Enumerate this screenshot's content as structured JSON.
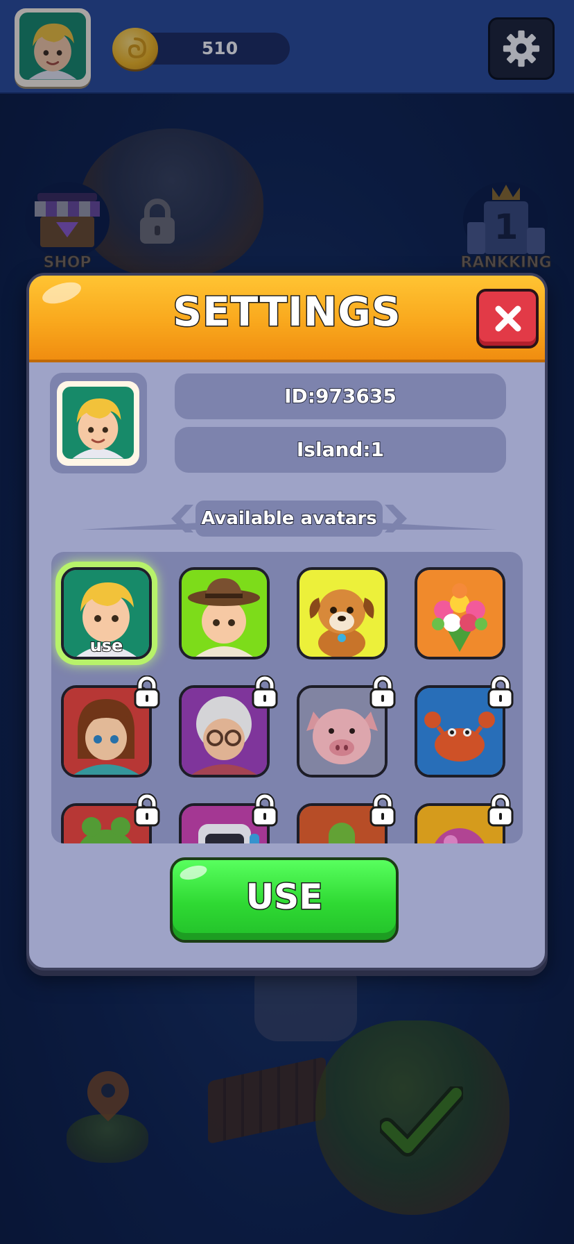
{
  "hud": {
    "coins": "510"
  },
  "background": {
    "shop_label": "SHOP",
    "ranking_label": "RANKKING",
    "ranking_number": "1"
  },
  "settings": {
    "title": "SETTINGS",
    "player_id": "ID:973635",
    "island": "Island:1",
    "section_title": "Available avatars",
    "use_button_label": "USE",
    "avatars": [
      {
        "name": "blond-boy",
        "state": "selected",
        "tag": "use",
        "bg": "#178a69"
      },
      {
        "name": "cowboy-boy",
        "state": "unlocked",
        "bg": "#7ddc1a"
      },
      {
        "name": "puppy",
        "state": "unlocked",
        "bg": "#ecf03a"
      },
      {
        "name": "flower-bouquet",
        "state": "unlocked",
        "bg": "#f08a2c"
      },
      {
        "name": "cat-girl",
        "state": "locked",
        "bg": "#c73c3a"
      },
      {
        "name": "grandma",
        "state": "locked",
        "bg": "#8a3aa8"
      },
      {
        "name": "pig",
        "state": "locked",
        "bg": "#8c8fb0"
      },
      {
        "name": "crab",
        "state": "locked",
        "bg": "#2b78c8"
      },
      {
        "name": "frog",
        "state": "locked",
        "bg": "#c73c3a"
      },
      {
        "name": "robot",
        "state": "locked",
        "bg": "#b23ca0"
      },
      {
        "name": "cactus",
        "state": "locked",
        "bg": "#c7542a"
      },
      {
        "name": "pink-ball",
        "state": "locked",
        "bg": "#e8a81e"
      }
    ]
  },
  "colors": {
    "header": "#f9a81d",
    "panel": "#9ea3c7",
    "panel_inner": "#7d83ad",
    "close": "#e23a47",
    "use_button": "#2fd933"
  }
}
